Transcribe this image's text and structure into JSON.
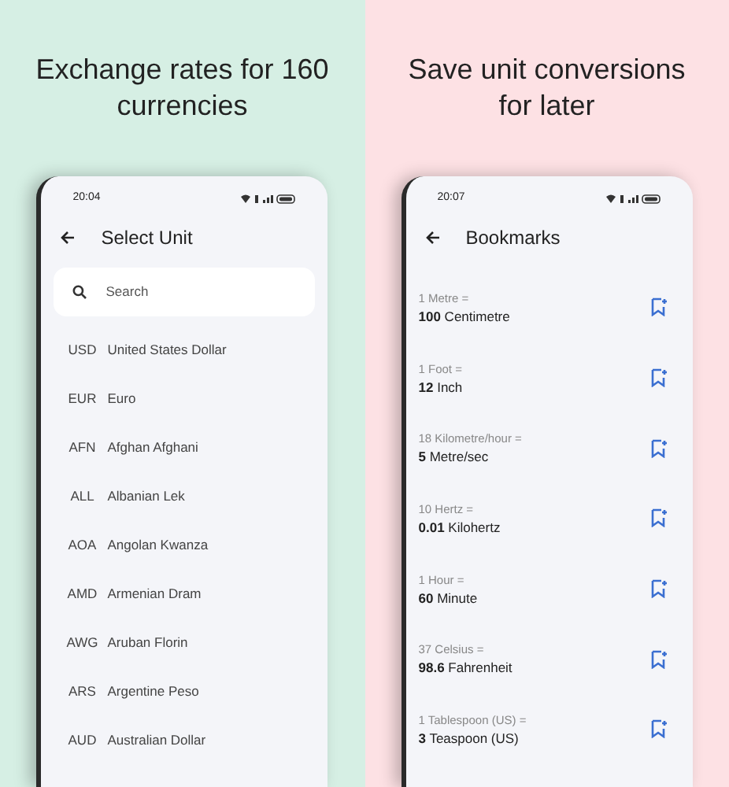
{
  "panels": [
    {
      "headline": "Exchange rates for 160 currencies",
      "time": "20:04",
      "title": "Select Unit",
      "kind": "currencies",
      "search": {
        "placeholder": "Search"
      },
      "items": [
        {
          "code": "USD",
          "name": "United States Dollar"
        },
        {
          "code": "EUR",
          "name": "Euro"
        },
        {
          "code": "AFN",
          "name": "Afghan Afghani"
        },
        {
          "code": "ALL",
          "name": "Albanian Lek"
        },
        {
          "code": "AOA",
          "name": "Angolan Kwanza"
        },
        {
          "code": "AMD",
          "name": "Armenian Dram"
        },
        {
          "code": "AWG",
          "name": "Aruban Florin"
        },
        {
          "code": "ARS",
          "name": "Argentine Peso"
        },
        {
          "code": "AUD",
          "name": "Australian Dollar"
        }
      ]
    },
    {
      "headline": "Save unit conversions for later",
      "time": "20:07",
      "title": "Bookmarks",
      "kind": "bookmarks",
      "items": [
        {
          "from": "1 Metre =",
          "to": "**100** Centimetre"
        },
        {
          "from": "1 Foot =",
          "to": "**12** Inch"
        },
        {
          "from": "18 Kilometre/hour =",
          "to": "**5** Metre/sec"
        },
        {
          "from": "10 Hertz =",
          "to": "**0.01** Kilohertz"
        },
        {
          "from": "1 Hour =",
          "to": "**60** Minute"
        },
        {
          "from": "37 Celsius =",
          "to": "**98.6** Fahrenheit"
        },
        {
          "from": "1 Tablespoon (US) =",
          "to": "**3** Teaspoon (US)"
        }
      ]
    }
  ]
}
